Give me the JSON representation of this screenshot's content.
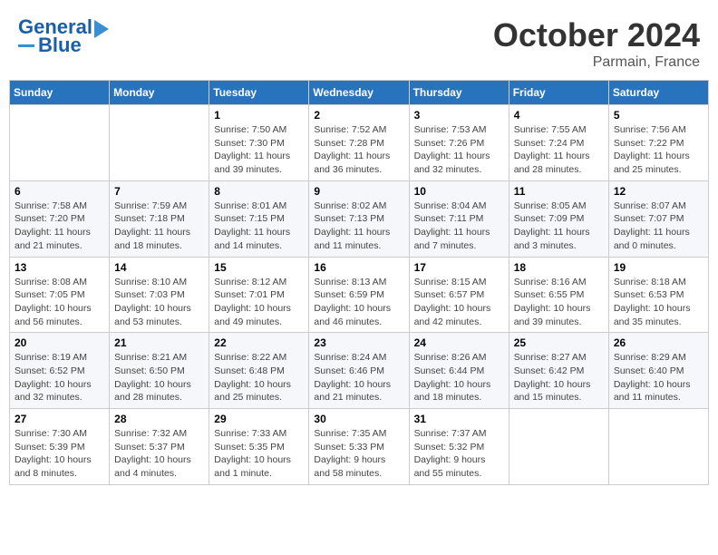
{
  "header": {
    "logo_line1": "General",
    "logo_line2": "Blue",
    "month": "October 2024",
    "location": "Parmain, France"
  },
  "weekdays": [
    "Sunday",
    "Monday",
    "Tuesday",
    "Wednesday",
    "Thursday",
    "Friday",
    "Saturday"
  ],
  "weeks": [
    [
      {
        "day": "",
        "info": ""
      },
      {
        "day": "",
        "info": ""
      },
      {
        "day": "1",
        "info": "Sunrise: 7:50 AM\nSunset: 7:30 PM\nDaylight: 11 hours and 39 minutes."
      },
      {
        "day": "2",
        "info": "Sunrise: 7:52 AM\nSunset: 7:28 PM\nDaylight: 11 hours and 36 minutes."
      },
      {
        "day": "3",
        "info": "Sunrise: 7:53 AM\nSunset: 7:26 PM\nDaylight: 11 hours and 32 minutes."
      },
      {
        "day": "4",
        "info": "Sunrise: 7:55 AM\nSunset: 7:24 PM\nDaylight: 11 hours and 28 minutes."
      },
      {
        "day": "5",
        "info": "Sunrise: 7:56 AM\nSunset: 7:22 PM\nDaylight: 11 hours and 25 minutes."
      }
    ],
    [
      {
        "day": "6",
        "info": "Sunrise: 7:58 AM\nSunset: 7:20 PM\nDaylight: 11 hours and 21 minutes."
      },
      {
        "day": "7",
        "info": "Sunrise: 7:59 AM\nSunset: 7:18 PM\nDaylight: 11 hours and 18 minutes."
      },
      {
        "day": "8",
        "info": "Sunrise: 8:01 AM\nSunset: 7:15 PM\nDaylight: 11 hours and 14 minutes."
      },
      {
        "day": "9",
        "info": "Sunrise: 8:02 AM\nSunset: 7:13 PM\nDaylight: 11 hours and 11 minutes."
      },
      {
        "day": "10",
        "info": "Sunrise: 8:04 AM\nSunset: 7:11 PM\nDaylight: 11 hours and 7 minutes."
      },
      {
        "day": "11",
        "info": "Sunrise: 8:05 AM\nSunset: 7:09 PM\nDaylight: 11 hours and 3 minutes."
      },
      {
        "day": "12",
        "info": "Sunrise: 8:07 AM\nSunset: 7:07 PM\nDaylight: 11 hours and 0 minutes."
      }
    ],
    [
      {
        "day": "13",
        "info": "Sunrise: 8:08 AM\nSunset: 7:05 PM\nDaylight: 10 hours and 56 minutes."
      },
      {
        "day": "14",
        "info": "Sunrise: 8:10 AM\nSunset: 7:03 PM\nDaylight: 10 hours and 53 minutes."
      },
      {
        "day": "15",
        "info": "Sunrise: 8:12 AM\nSunset: 7:01 PM\nDaylight: 10 hours and 49 minutes."
      },
      {
        "day": "16",
        "info": "Sunrise: 8:13 AM\nSunset: 6:59 PM\nDaylight: 10 hours and 46 minutes."
      },
      {
        "day": "17",
        "info": "Sunrise: 8:15 AM\nSunset: 6:57 PM\nDaylight: 10 hours and 42 minutes."
      },
      {
        "day": "18",
        "info": "Sunrise: 8:16 AM\nSunset: 6:55 PM\nDaylight: 10 hours and 39 minutes."
      },
      {
        "day": "19",
        "info": "Sunrise: 8:18 AM\nSunset: 6:53 PM\nDaylight: 10 hours and 35 minutes."
      }
    ],
    [
      {
        "day": "20",
        "info": "Sunrise: 8:19 AM\nSunset: 6:52 PM\nDaylight: 10 hours and 32 minutes."
      },
      {
        "day": "21",
        "info": "Sunrise: 8:21 AM\nSunset: 6:50 PM\nDaylight: 10 hours and 28 minutes."
      },
      {
        "day": "22",
        "info": "Sunrise: 8:22 AM\nSunset: 6:48 PM\nDaylight: 10 hours and 25 minutes."
      },
      {
        "day": "23",
        "info": "Sunrise: 8:24 AM\nSunset: 6:46 PM\nDaylight: 10 hours and 21 minutes."
      },
      {
        "day": "24",
        "info": "Sunrise: 8:26 AM\nSunset: 6:44 PM\nDaylight: 10 hours and 18 minutes."
      },
      {
        "day": "25",
        "info": "Sunrise: 8:27 AM\nSunset: 6:42 PM\nDaylight: 10 hours and 15 minutes."
      },
      {
        "day": "26",
        "info": "Sunrise: 8:29 AM\nSunset: 6:40 PM\nDaylight: 10 hours and 11 minutes."
      }
    ],
    [
      {
        "day": "27",
        "info": "Sunrise: 7:30 AM\nSunset: 5:39 PM\nDaylight: 10 hours and 8 minutes."
      },
      {
        "day": "28",
        "info": "Sunrise: 7:32 AM\nSunset: 5:37 PM\nDaylight: 10 hours and 4 minutes."
      },
      {
        "day": "29",
        "info": "Sunrise: 7:33 AM\nSunset: 5:35 PM\nDaylight: 10 hours and 1 minute."
      },
      {
        "day": "30",
        "info": "Sunrise: 7:35 AM\nSunset: 5:33 PM\nDaylight: 9 hours and 58 minutes."
      },
      {
        "day": "31",
        "info": "Sunrise: 7:37 AM\nSunset: 5:32 PM\nDaylight: 9 hours and 55 minutes."
      },
      {
        "day": "",
        "info": ""
      },
      {
        "day": "",
        "info": ""
      }
    ]
  ]
}
